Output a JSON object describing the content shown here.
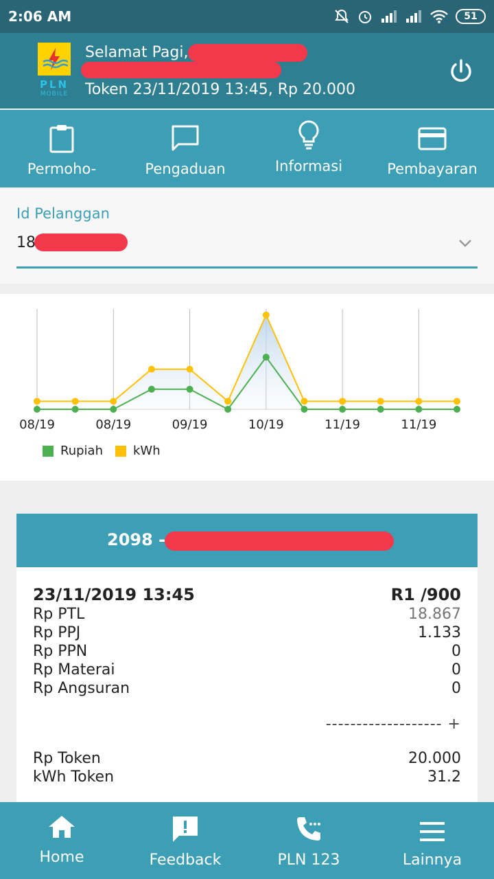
{
  "status_bar": {
    "time": "2:06 AM",
    "battery": "51"
  },
  "header": {
    "greeting": "Selamat Pagi,",
    "token_info": "Token 23/11/2019 13:45, Rp 20.000",
    "logo_text": "PLN",
    "logo_sub": "MOBILE"
  },
  "menu": {
    "items": [
      {
        "label": "Permoho-",
        "icon": "clipboard-icon"
      },
      {
        "label": "Pengaduan",
        "icon": "chat-icon"
      },
      {
        "label": "Informasi",
        "icon": "lightbulb-icon"
      },
      {
        "label": "Pembayaran",
        "icon": "credit-card-icon"
      }
    ]
  },
  "customer": {
    "label": "Id Pelanggan",
    "value_prefix": "18"
  },
  "chart_data": {
    "type": "line",
    "x": [
      "08/19",
      "08/19",
      "08/19",
      "08/19",
      "09/19",
      "09/19",
      "10/19",
      "10/19",
      "11/19",
      "11/19",
      "11/19",
      "11/19"
    ],
    "tick_labels": [
      "08/19",
      "08/19",
      "09/19",
      "10/19",
      "11/19",
      "11/19"
    ],
    "series": [
      {
        "name": "Rupiah",
        "color": "#4caf50",
        "values": [
          0,
          0,
          0,
          1,
          1,
          0,
          2.6,
          0,
          0,
          0,
          0,
          0
        ]
      },
      {
        "name": "kWh",
        "color": "#ffc107",
        "values": [
          0.4,
          0.4,
          0.4,
          2.0,
          2.0,
          0.4,
          4.7,
          0.4,
          0.4,
          0.4,
          0.4,
          0.4
        ]
      }
    ],
    "ylim": [
      0,
      5
    ],
    "grid": "vertical",
    "legend": "bottom-left"
  },
  "receipt": {
    "title_prefix": "2098 -",
    "date": "23/11/2019 13:45",
    "tariff": "R1 /900",
    "rows": [
      {
        "label": "Rp PTL",
        "value": "18.867"
      },
      {
        "label": "Rp PPJ",
        "value": "1.133"
      },
      {
        "label": "Rp PPN",
        "value": "0"
      },
      {
        "label": "Rp Materai",
        "value": "0"
      },
      {
        "label": "Rp Angsuran",
        "value": "0"
      }
    ],
    "separator": "------------------- +",
    "token_label": "Rp Token",
    "token_value": "20.000",
    "kwh_label": "kWh Token",
    "kwh_value": "31.2"
  },
  "bottom_nav": {
    "items": [
      {
        "label": "Home",
        "icon": "home-icon"
      },
      {
        "label": "Feedback",
        "icon": "feedback-icon"
      },
      {
        "label": "PLN 123",
        "icon": "phone-icon"
      },
      {
        "label": "Lainnya",
        "icon": "menu-icon"
      }
    ]
  }
}
